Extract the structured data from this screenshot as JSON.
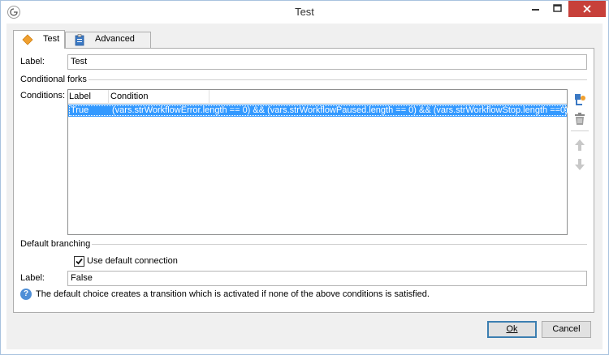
{
  "window": {
    "title": "Test",
    "colors": {
      "close_button": "#c7403a",
      "selection": "#3399ff",
      "help_icon": "#4f8fd7",
      "tab_icon_orange": "#f0a030"
    }
  },
  "tabs": [
    {
      "label": "Test",
      "icon": "diamond-icon",
      "active": true
    },
    {
      "label": "Advanced",
      "icon": "clipboard-icon",
      "active": false
    }
  ],
  "form": {
    "label_caption": "Label:",
    "label_value": "Test",
    "conditional_forks_heading": "Conditional forks",
    "conditions_caption": "Conditions:",
    "conditions_table": {
      "columns": [
        "Label",
        "Condition"
      ],
      "rows": [
        {
          "label": "True",
          "condition": "(vars.strWorkflowError.length == 0) && (vars.strWorkflowPaused.length == 0) && (vars.strWorkflowStop.length ==0)",
          "selected": true
        }
      ]
    },
    "side_actions": [
      "add-icon",
      "delete-icon",
      "move-up-icon",
      "move-down-icon"
    ],
    "default_branching_heading": "Default branching",
    "use_default_connection_label": "Use default connection",
    "use_default_connection_checked": true,
    "default_label_caption": "Label:",
    "default_label_value": "False",
    "help_text": "The default choice creates a transition which is activated if none of the above conditions is satisfied."
  },
  "buttons": {
    "ok": "Ok",
    "cancel": "Cancel"
  }
}
